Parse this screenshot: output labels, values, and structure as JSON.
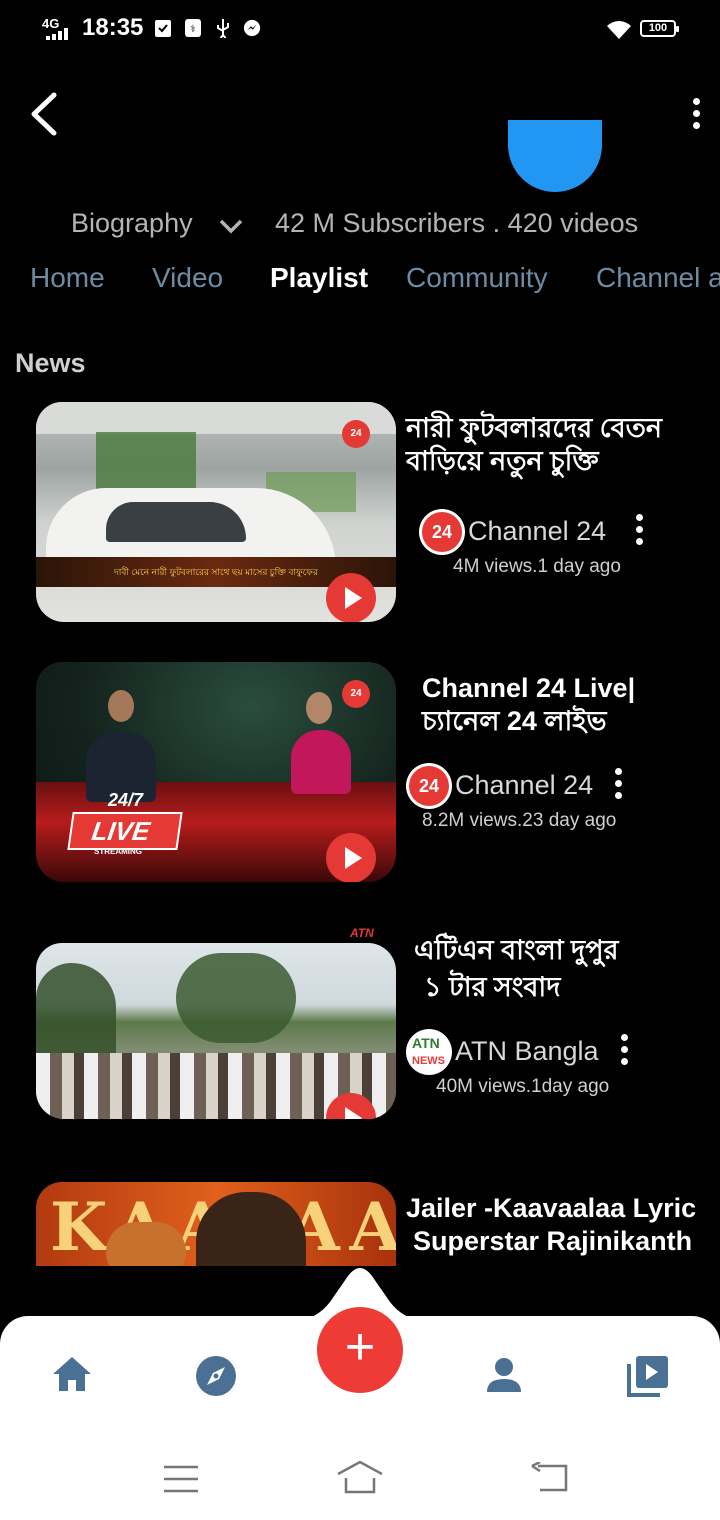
{
  "status_bar": {
    "network": "4G",
    "time": "18:35",
    "battery": "100"
  },
  "header": {
    "biography_label": "Biography",
    "stats": "42 M Subscribers . 420 videos"
  },
  "tabs": [
    {
      "label": "Home"
    },
    {
      "label": "Video"
    },
    {
      "label": "Playlist"
    },
    {
      "label": "Community"
    },
    {
      "label": "Channel a"
    }
  ],
  "section": {
    "title": "News"
  },
  "videos": [
    {
      "title_line1": "নারী ফুটবলারদের বেতন",
      "title_line2": "বাড়িয়ে নতুন চুক্তি",
      "channel": "Channel 24",
      "views": "4M views.1 day ago",
      "caption": "দাবী মেনে নারী ফুটবলারের সাথে ছয় মাসের চুক্তি বাফুফের",
      "logo_text": "24"
    },
    {
      "title_line1": "Channel 24 Live|",
      "title_line2": "চ্যানেল 24 লাইভ",
      "channel": "Channel 24",
      "views": "8.2M views.23 day ago",
      "badge_top": "24/7",
      "badge_live": "LIVE",
      "badge_sub": "STREAMING",
      "logo_text": "24"
    },
    {
      "title_line1": "এটিএন বাংলা দুপুর",
      "title_line2": "১ টার সংবাদ",
      "channel": "ATN Bangla",
      "views": "40M views.1day ago",
      "logo_text": "ATN",
      "logo_sub": "NEWS"
    },
    {
      "title_line1": "Jailer -Kaavaalaa Lyric",
      "title_line2": "Superstar Rajinikanth",
      "thumb_text": "KAAVAALAA"
    }
  ],
  "colors": {
    "accent": "#ef3b36",
    "blue": "#2196f3",
    "tab_inactive": "#6d8ca3",
    "nav_icon": "#4a7093"
  },
  "icons": [
    "back-arrow-icon",
    "more-vert-icon",
    "chevron-down-icon",
    "home-icon",
    "explore-icon",
    "add-icon",
    "person-icon",
    "library-icon"
  ],
  "fab": {
    "label": "+"
  }
}
